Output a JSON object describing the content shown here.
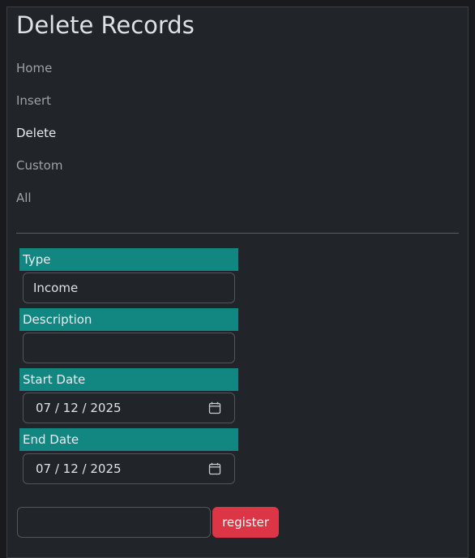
{
  "page": {
    "title": "Delete Records"
  },
  "nav": {
    "items": [
      {
        "label": "Home"
      },
      {
        "label": "Insert"
      },
      {
        "label": "Delete"
      },
      {
        "label": "Custom"
      },
      {
        "label": "All"
      }
    ],
    "active": "Delete"
  },
  "form": {
    "type": {
      "label": "Type",
      "value": "Income"
    },
    "description": {
      "label": "Description",
      "value": ""
    },
    "start_date": {
      "label": "Start Date",
      "value": "07 / 12 / 2025"
    },
    "end_date": {
      "label": "End Date",
      "value": "07 / 12 / 2025"
    }
  },
  "register": {
    "input_value": "",
    "button_label": "register"
  },
  "colors": {
    "background": "#212529",
    "label_bg": "#128782",
    "button_bg": "#dc3545"
  },
  "icons": {
    "date_picker": "calendar-icon"
  }
}
